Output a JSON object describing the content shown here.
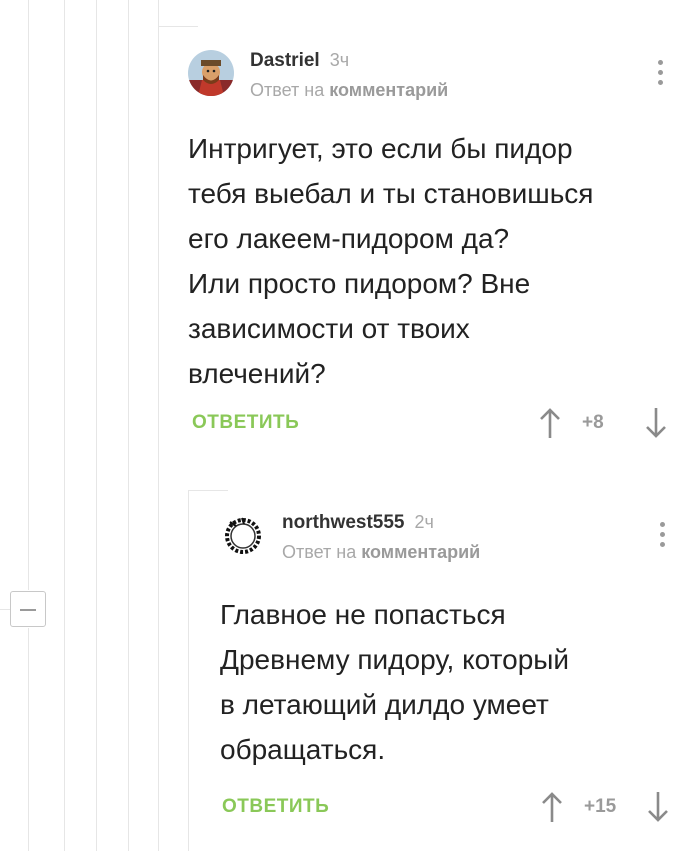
{
  "comments": [
    {
      "author": "Dastriel",
      "time": "3ч",
      "reply_prefix": "Ответ на",
      "reply_target": "комментарий",
      "text_lines": [
        "Интригует, это если бы пидор",
        "тебя выебал и ты становишься",
        "его лакеем-пидором да?",
        "Или просто пидором? Вне",
        "зависимости от твоих",
        "влечений?"
      ],
      "reply_label": "ОТВЕТИТЬ",
      "rating": "+8"
    },
    {
      "author": "northwest555",
      "time": "2ч",
      "reply_prefix": "Ответ на",
      "reply_target": "комментарий",
      "text_lines": [
        "Главное не попасться",
        "Древнему пидору, который",
        "в летающий дилдо умеет",
        "обращаться."
      ],
      "reply_label": "ОТВЕТИТЬ",
      "rating": "+15"
    }
  ],
  "colors": {
    "reply_green": "#8ac858",
    "muted_gray": "#a8a8a8",
    "thread_line": "#e6e6e6"
  },
  "icons": {
    "collapse": "minus-icon",
    "upvote": "arrow-up-icon",
    "downvote": "arrow-down-icon",
    "menu": "more-vertical-icon"
  }
}
